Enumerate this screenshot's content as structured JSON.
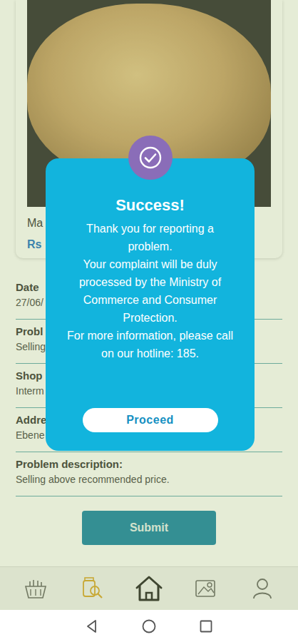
{
  "product": {
    "name": "Ma",
    "price": "Rs"
  },
  "form": {
    "fields": [
      {
        "label": "Date",
        "value": "27/06/"
      },
      {
        "label": "Probl",
        "value": "Selling"
      },
      {
        "label": "Shop",
        "value": "Interm"
      },
      {
        "label": "Addre",
        "value": "Ebene"
      },
      {
        "label": "Problem description:",
        "value": "Selling above recommended price."
      }
    ],
    "submit": "Submit"
  },
  "nav": {
    "items": [
      {
        "selected": false
      },
      {
        "selected": true
      },
      {
        "selected": false
      },
      {
        "selected": false
      },
      {
        "selected": false
      }
    ]
  },
  "modal": {
    "title": "Success!",
    "message": [
      "Thank you for reporting a problem.",
      "Your complaint will be duly processed by the Ministry of Commerce and Consumer Protection.",
      "For more information, please call on our hotline: 185."
    ],
    "button": "Proceed"
  }
}
